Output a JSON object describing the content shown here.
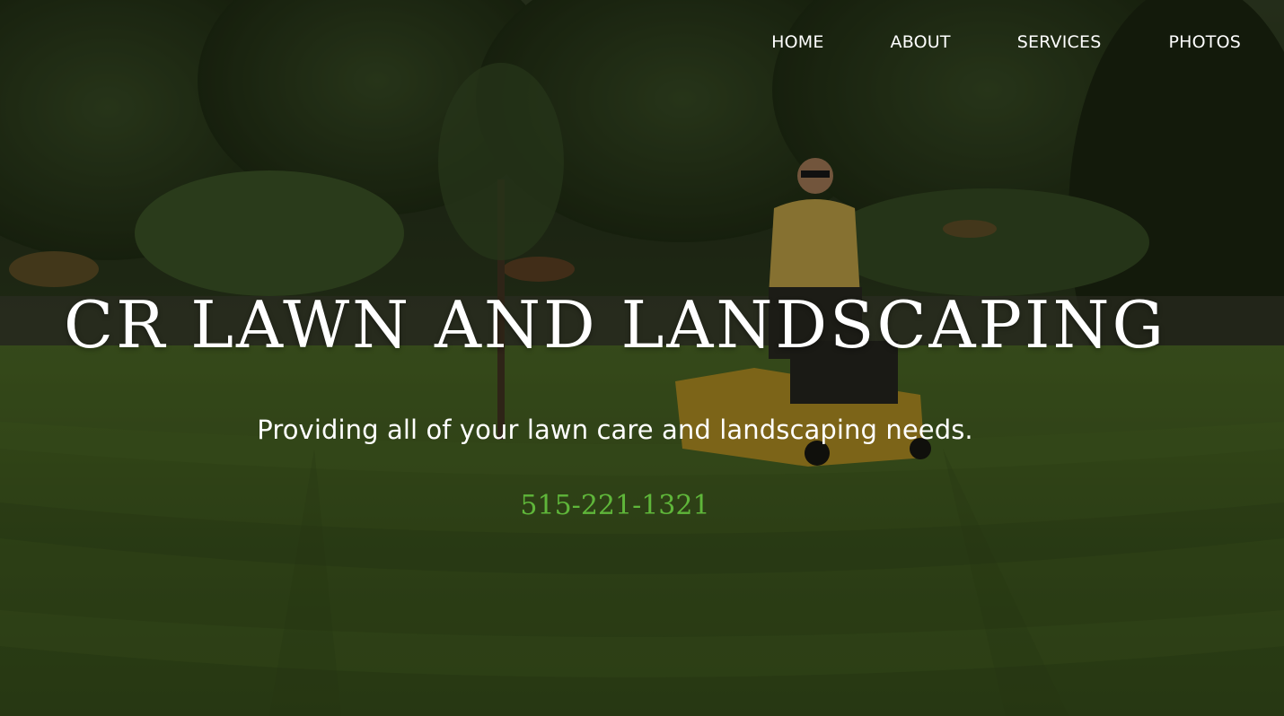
{
  "nav": {
    "items": [
      {
        "label": "HOME"
      },
      {
        "label": "ABOUT"
      },
      {
        "label": "SERVICES"
      },
      {
        "label": "PHOTOS"
      }
    ]
  },
  "hero": {
    "title": "CR LAWN AND LANDSCAPING",
    "tagline": "Providing all of your lawn care and landscaping needs.",
    "phone": "515-221-1321",
    "phone_color": "#5fb63a",
    "background_description_colors": {
      "lawn": "#4a6a22",
      "trees": "#2b3a1a",
      "shirt": "#d6b24a",
      "mower": "#c9a227"
    }
  }
}
